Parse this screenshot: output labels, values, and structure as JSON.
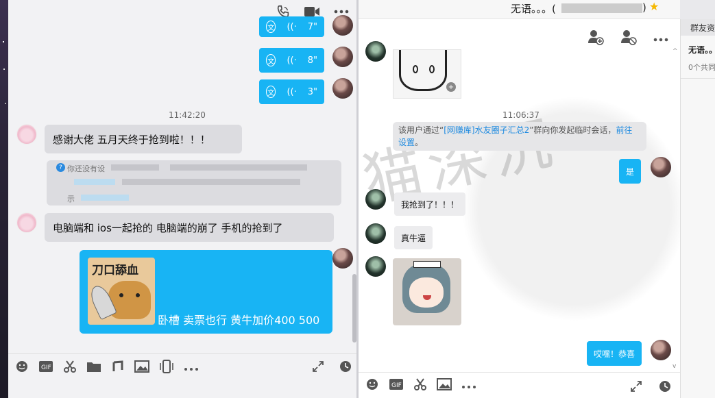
{
  "left_chat": {
    "voice_messages": [
      {
        "duration": "7\""
      },
      {
        "duration": "8\""
      },
      {
        "duration": "3\""
      }
    ],
    "timestamp": "11:42:20",
    "messages": [
      {
        "text": "感谢大佬  五月天终于抢到啦！！！"
      },
      {
        "text": "电脑端和 ios一起抢的   电脑端的崩了   手机的抢到了"
      }
    ],
    "blurred_notice": {
      "line1": "你还没有设",
      "line3": "示"
    },
    "reply_with_image": {
      "sticker_text": "刀口舔血",
      "caption": "卧槽   卖票也行 黄牛加价400 500"
    }
  },
  "right_chat": {
    "title": "无语。。。(",
    "title_suffix": ")",
    "timestamp": "11:06:37",
    "system_notice": {
      "pre": "该用户通过“",
      "group_link": "[网赚库]水友圈子汇总2",
      "mid": "”群向你发起临时会话，",
      "action_link": "前往",
      "action_link2": "设置",
      "end": "。"
    },
    "messages": [
      {
        "text": "是"
      },
      {
        "text": "我抢到了！！！"
      },
      {
        "text": "真牛逼"
      },
      {
        "text": "哎嘿！恭喜"
      }
    ],
    "watermark": "猫深沉"
  },
  "side_panel": {
    "tab_label": "群友资",
    "name": "无语。。",
    "sub": "0个共同"
  },
  "colors": {
    "accent_blue": "#18b4f4",
    "link_blue": "#1d8ae0",
    "star": "#f5b800"
  }
}
